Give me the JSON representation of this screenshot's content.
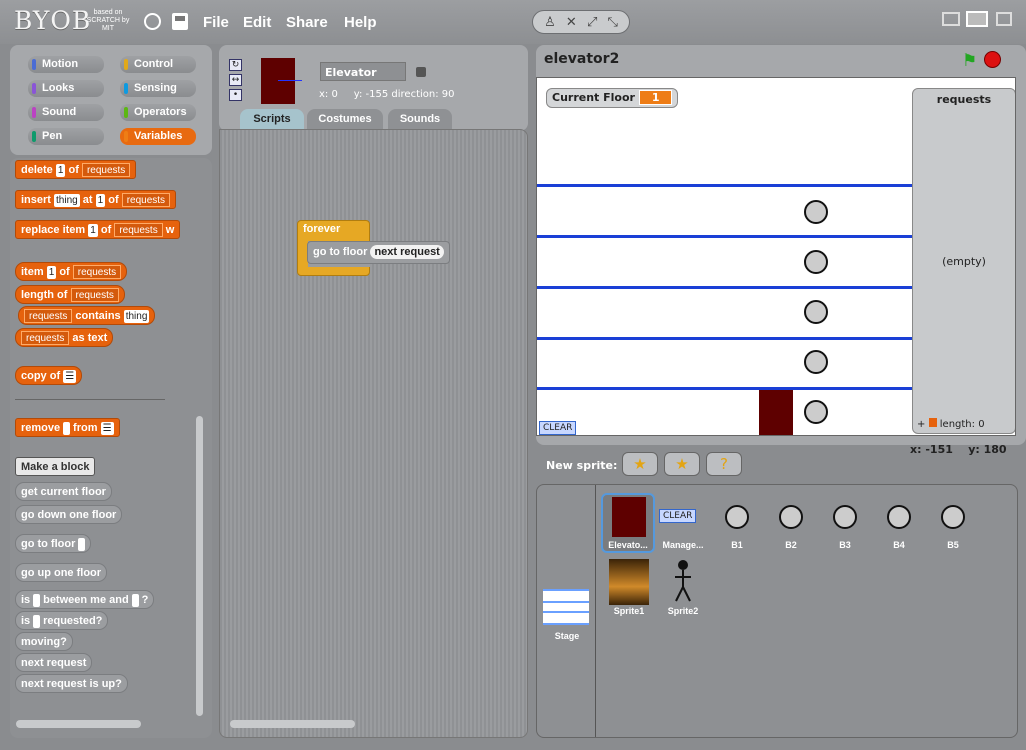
{
  "topbar": {
    "logo": "BYOB",
    "logo_sub": "based on SCRATCH by MIT",
    "menus": [
      "File",
      "Edit",
      "Share",
      "Help"
    ]
  },
  "categories": [
    {
      "label": "Motion",
      "color": "#4a6cd4"
    },
    {
      "label": "Control",
      "color": "#e1a91a"
    },
    {
      "label": "Looks",
      "color": "#8a55d7"
    },
    {
      "label": "Sensing",
      "color": "#0e9ae0"
    },
    {
      "label": "Sound",
      "color": "#bb42c3"
    },
    {
      "label": "Operators",
      "color": "#5cb712"
    },
    {
      "label": "Pen",
      "color": "#0e9a6c"
    },
    {
      "label": "Variables",
      "color": "#ee7d16"
    }
  ],
  "palette": {
    "delete": "delete",
    "of": "of",
    "one": "1",
    "list": "requests",
    "insert": "insert",
    "thing": "thing",
    "at": "at",
    "replace": "replace item",
    "with": "w",
    "item": "item",
    "length": "length of",
    "contains": "contains",
    "as_text": "as text",
    "copy": "copy of",
    "remove": "remove",
    "from": "from",
    "make_block": "Make a block",
    "custom": [
      "get current floor",
      "go down one floor",
      "go to floor",
      "go up one floor"
    ],
    "is": "is",
    "between": "between me and",
    "q": "?",
    "requested": "requested?",
    "moving": "moving?",
    "next_request": "next request",
    "next_up": "next request is up?"
  },
  "sprite": {
    "name": "Elevator",
    "x_label": "x:",
    "x": "0",
    "y_label": "y:",
    "y": "-155",
    "dir_label": "direction:",
    "dir": "90"
  },
  "tabs": [
    "Scripts",
    "Costumes",
    "Sounds"
  ],
  "script": {
    "hat": "forever",
    "cmd": "go to floor",
    "reporter": "next request"
  },
  "stage": {
    "title": "elevator2",
    "watcher_label": "Current Floor",
    "watcher_value": "1",
    "list_title": "requests",
    "list_empty": "(empty)",
    "list_length": "length: 0",
    "clear": "CLEAR",
    "mouse_x_label": "x:",
    "mouse_x": "-151",
    "mouse_y_label": "y:",
    "mouse_y": "180"
  },
  "new_sprite_label": "New sprite:",
  "sprites": [
    "Elevato...",
    "Manage...",
    "B1",
    "B2",
    "B3",
    "B4",
    "B5",
    "Sprite1",
    "Sprite2"
  ],
  "sprite_clear": "CLEAR",
  "stage_label": "Stage"
}
